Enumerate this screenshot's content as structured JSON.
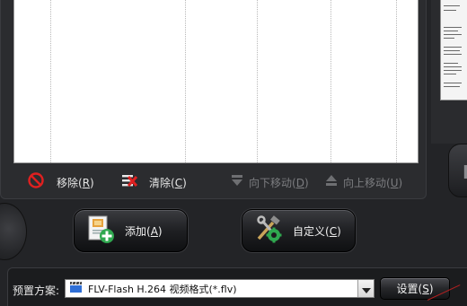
{
  "toolbar": {
    "remove_label": "移除",
    "remove_key": "R",
    "clear_label": "清除",
    "clear_key": "C",
    "move_down_label": "向下移动",
    "move_down_key": "D",
    "move_up_label": "向上移动",
    "move_up_key": "U",
    "move_buttons_state": "disabled"
  },
  "actions": {
    "add_label": "添加",
    "add_key": "A",
    "customize_label": "自定义",
    "customize_key": "C"
  },
  "preset": {
    "label": "预置方案:",
    "selected_value": "FLV-Flash H.264 视频格式(*.flv)",
    "settings_label": "设置",
    "settings_key": "S"
  },
  "icons": {
    "remove": "no-entry-icon",
    "clear": "clear-list-icon",
    "move_down": "arrow-down-icon",
    "move_up": "arrow-up-icon",
    "add": "add-file-icon",
    "customize": "tools-gear-icon",
    "format": "video-clapper-icon",
    "dropdown": "chevron-down-icon"
  },
  "colors": {
    "remove_red": "#e02020",
    "add_green": "#2fa84f",
    "background": "#232427",
    "panel_border": "#3a3b3f",
    "disabled_text": "#7c7d80"
  }
}
